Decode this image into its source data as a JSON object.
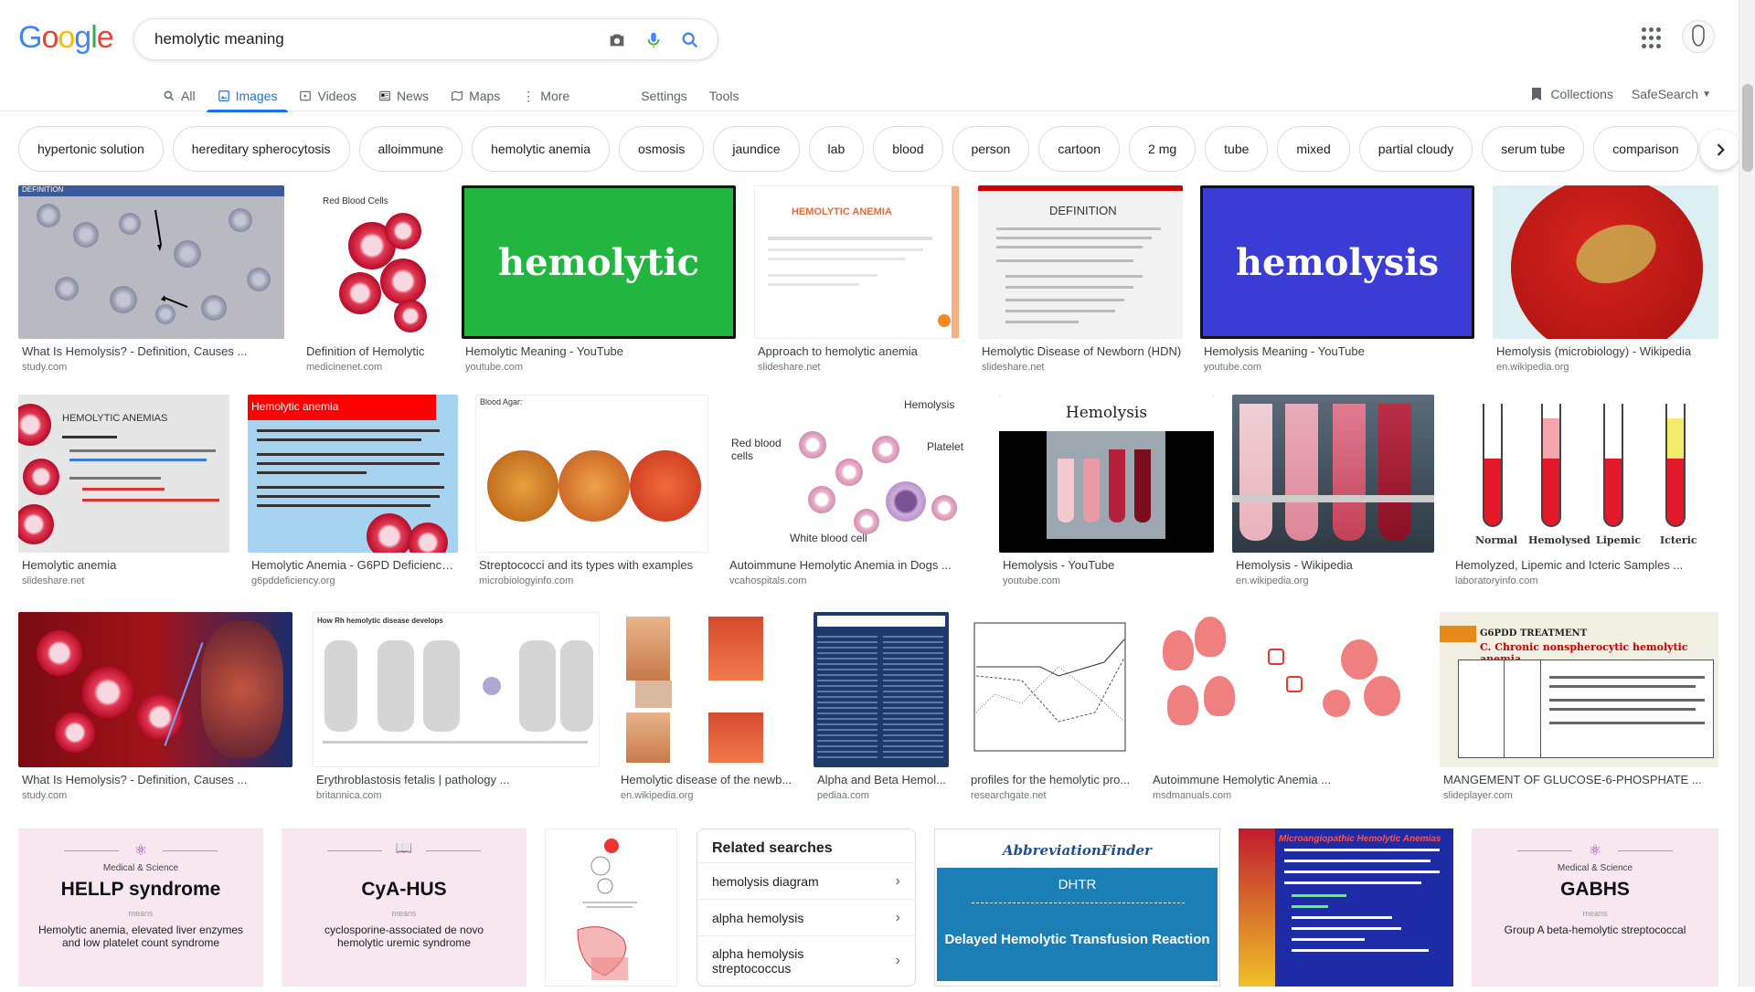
{
  "search": {
    "query": "hemolytic meaning"
  },
  "logo": {
    "letters": [
      "G",
      "o",
      "o",
      "g",
      "l",
      "e"
    ],
    "colors": [
      "#4285f4",
      "#ea4335",
      "#fbbc05",
      "#4285f4",
      "#34a853",
      "#ea4335"
    ]
  },
  "tabs": [
    {
      "label": "All",
      "icon": "search-icon"
    },
    {
      "label": "Images",
      "icon": "image-icon",
      "active": true
    },
    {
      "label": "Videos",
      "icon": "video-icon"
    },
    {
      "label": "News",
      "icon": "news-icon"
    },
    {
      "label": "Maps",
      "icon": "map-icon"
    },
    {
      "label": "More",
      "icon": "more-vert-icon"
    }
  ],
  "tools": {
    "settings": "Settings",
    "tools": "Tools",
    "collections": "Collections",
    "safesearch": "SafeSearch"
  },
  "chips": [
    "hypertonic solution",
    "hereditary spherocytosis",
    "alloimmune",
    "hemolytic anemia",
    "osmosis",
    "jaundice",
    "lab",
    "blood",
    "person",
    "cartoon",
    "2 mg",
    "tube",
    "mixed",
    "partial cloudy",
    "serum tube",
    "comparison",
    "d"
  ],
  "results": {
    "r1": [
      {
        "caption": "What Is Hemolysis? - Definition, Causes ...",
        "source": "study.com",
        "label": "DEFINITION"
      },
      {
        "caption": "Definition of Hemolytic",
        "source": "medicinenet.com",
        "label": "Red Blood Cells"
      },
      {
        "caption": "Hemolytic Meaning - YouTube",
        "source": "youtube.com",
        "label": "hemolytic"
      },
      {
        "caption": "Approach to hemolytic anemia",
        "source": "slideshare.net",
        "label": "Hemolytic Anemia"
      },
      {
        "caption": "Hemolytic Disease of Newborn (HDN)",
        "source": "slideshare.net",
        "label": "DEFINITION"
      },
      {
        "caption": "Hemolysis Meaning - YouTube",
        "source": "youtube.com",
        "label": "hemolysis"
      },
      {
        "caption": "Hemolysis (microbiology) - Wikipedia",
        "source": "en.wikipedia.org"
      }
    ],
    "r2": [
      {
        "caption": "Hemolytic anemia",
        "source": "slideshare.net",
        "label": "HEMOLYTIC ANEMIAS"
      },
      {
        "caption": "Hemolytic Anemia - G6PD Deficiency ...",
        "source": "g6pddeficiency.org",
        "label": "Hemolytic anemia"
      },
      {
        "caption": "Streptococci and its types with examples",
        "source": "microbiologyinfo.com",
        "label": "Blood Agar:"
      },
      {
        "caption": "Autoimmune Hemolytic Anemia in Dogs ...",
        "source": "vcahospitals.com"
      },
      {
        "caption": "Hemolysis - YouTube",
        "source": "youtube.com",
        "label": "Hemolysis"
      },
      {
        "caption": "Hemolysis - Wikipedia",
        "source": "en.wikipedia.org"
      },
      {
        "caption": "Hemolyzed, Lipemic and Icteric Samples ...",
        "source": "laboratoryinfo.com"
      }
    ],
    "r3": [
      {
        "caption": "What Is Hemolysis? - Definition, Causes ...",
        "source": "study.com"
      },
      {
        "caption": "Erythroblastosis fetalis | pathology ...",
        "source": "britannica.com",
        "label": "How Rh hemolytic disease develops"
      },
      {
        "caption": "Hemolytic disease of the newb...",
        "source": "en.wikipedia.org"
      },
      {
        "caption": "Alpha and Beta Hemol...",
        "source": "pediaa.com"
      },
      {
        "caption": "profiles for the hemolytic pro...",
        "source": "researchgate.net"
      },
      {
        "caption": "Autoimmune Hemolytic Anemia ...",
        "source": "msdmanuals.com"
      },
      {
        "caption": "MANGEMENT OF GLUCOSE-6-PHOSPHATE ...",
        "source": "slideplayer.com",
        "label": "G6PDD TREATMENT",
        "sub": "C. Chronic nonspherocytic hemolytic anemia"
      }
    ],
    "r4": {
      "hellp": {
        "small": "Medical & Science",
        "title": "HELLP syndrome",
        "means": "means",
        "desc": "Hemolytic anemia, elevated liver enzymes and low platelet count syndrome"
      },
      "cyahus": {
        "title": "CyA-HUS",
        "means": "means",
        "desc": "cyclosporine-associated de novo hemolytic uremic syndrome"
      },
      "abbrev": {
        "brand": "AbbreviationFinder",
        "code": "DHTR",
        "desc": "Delayed Hemolytic Transfusion Reaction"
      },
      "micro": {
        "title": "Microangiopathic Hemolytic Anemias"
      },
      "gabhs": {
        "small": "Medical & Science",
        "title": "GABHS",
        "means": "means",
        "desc": "Group A beta-hemolytic streptococcal"
      }
    }
  },
  "related": {
    "title": "Related searches",
    "items": [
      "hemolysis diagram",
      "alpha hemolysis",
      "alpha hemolysis streptococcus"
    ]
  },
  "misc": {
    "hemolysis_labels": {
      "hemolysis": "Hemolysis",
      "platelet": "Platelet",
      "rbc": "Red blood cells",
      "wbc": "White blood cell"
    },
    "tube_labels": [
      "Normal",
      "Hemolysed",
      "Lipemic",
      "Icteric"
    ]
  }
}
